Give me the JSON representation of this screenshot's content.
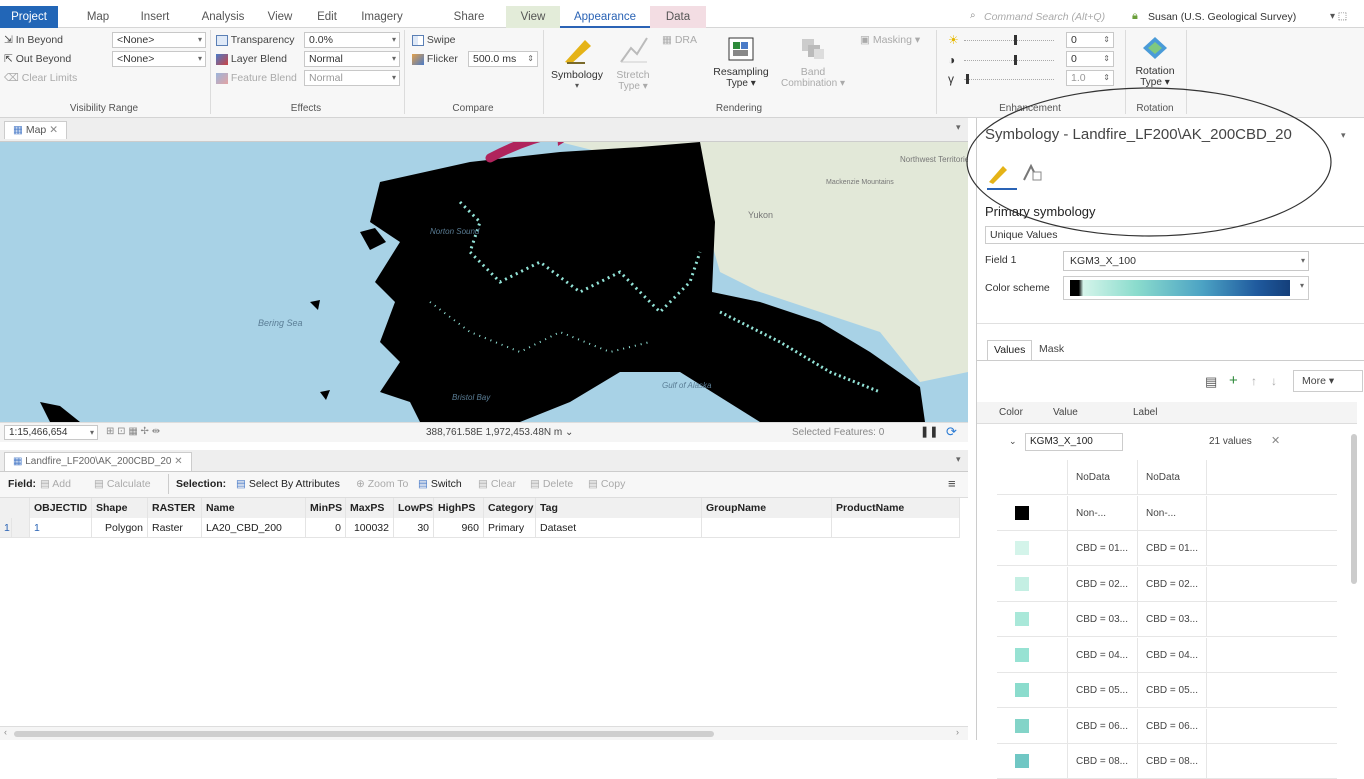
{
  "menubar": {
    "tabs": [
      "Project",
      "Map",
      "Insert",
      "Analysis",
      "View",
      "Edit",
      "Imagery",
      "Share",
      "View",
      "Appearance",
      "Data"
    ],
    "search_placeholder": "Command Search (Alt+Q)",
    "user": "Susan (U.S. Geological Survey)"
  },
  "ribbon": {
    "visibility": {
      "zoom_in_beyond": "In Beyond",
      "zoom_out_beyond": "Out Beyond",
      "clear_limits": "Clear Limits",
      "in_value": "<None>",
      "out_value": "<None>",
      "label": "Visibility Range"
    },
    "effects": {
      "transparency": "Transparency",
      "transparency_value": "0.0%",
      "layer_blend": "Layer Blend",
      "layer_blend_value": "Normal",
      "feature_blend": "Feature Blend",
      "feature_blend_value": "Normal",
      "label": "Effects"
    },
    "compare": {
      "swipe": "Swipe",
      "flicker": "Flicker",
      "flicker_value": "500.0",
      "flicker_unit": "ms",
      "label": "Compare"
    },
    "rendering": {
      "symbology": "Symbology",
      "stretch": "Stretch",
      "stretch_sub": "Type",
      "dra": "DRA",
      "resampling": "Resampling",
      "resampling_sub": "Type",
      "band": "Band",
      "band_sub": "Combination",
      "masking": "Masking",
      "label": "Rendering"
    },
    "enhancement": {
      "brightness": "0",
      "contrast": "0",
      "gamma": "1.0",
      "label": "Enhancement"
    },
    "rotation": {
      "label_top": "Rotation",
      "label_bottom": "Type",
      "label": "Rotation"
    }
  },
  "map": {
    "tab": "Map",
    "labels": {
      "north_sound": "Norton Sound",
      "bering": "Bering Sea",
      "bristol": "Bristol Bay",
      "gulf": "Gulf of Alaska",
      "yukon": "Yukon",
      "nwt": "Northwest Territories",
      "mackenzie": "Mackenzie Mountains"
    },
    "scale": "1:15,466,654",
    "coords": "388,761.58E 1,972,453.48N m",
    "selected": "Selected Features: 0"
  },
  "table": {
    "tab": "Landfire_LF200\\AK_200CBD_20",
    "toolbar": {
      "field": "Field:",
      "add": "Add",
      "calculate": "Calculate",
      "selection": "Selection:",
      "select_by_attr": "Select By Attributes",
      "zoom_to": "Zoom To",
      "switch": "Switch",
      "clear": "Clear",
      "delete": "Delete",
      "copy": "Copy"
    },
    "columns": [
      "OBJECTID",
      "Shape",
      "RASTER",
      "Name",
      "MinPS",
      "MaxPS",
      "LowPS",
      "HighPS",
      "Category",
      "Tag",
      "GroupName",
      "ProductName"
    ],
    "rows": [
      {
        "num": "1",
        "OBJECTID": "1",
        "Shape": "Polygon",
        "RASTER": "Raster",
        "Name": "LA20_CBD_200",
        "MinPS": "0",
        "MaxPS": "100032",
        "LowPS": "30",
        "HighPS": "960",
        "Category": "Primary",
        "Tag": "Dataset",
        "GroupName": "",
        "ProductName": ""
      }
    ]
  },
  "pane": {
    "title": "Symbology - Landfire_LF200\\AK_200CBD_20",
    "primary": "Primary symbology",
    "renderer": "Unique Values",
    "field1_label": "Field 1",
    "field1_value": "KGM3_X_100",
    "color_scheme_label": "Color scheme",
    "tabs": [
      "Values",
      "Mask"
    ],
    "more": "More",
    "col_color": "Color",
    "col_value": "Value",
    "col_label": "Label",
    "group_field": "KGM3_X_100",
    "group_count": "21 values",
    "values": [
      {
        "value": "NoData",
        "label": "NoData",
        "color": ""
      },
      {
        "value": "Non-...",
        "label": "Non-...",
        "color": "#000000"
      },
      {
        "value": "CBD = 01...",
        "label": "CBD = 01...",
        "color": "#d4f4ea"
      },
      {
        "value": "CBD = 02...",
        "label": "CBD = 02...",
        "color": "#c4efe3"
      },
      {
        "value": "CBD = 03...",
        "label": "CBD = 03...",
        "color": "#a9e8d9"
      },
      {
        "value": "CBD = 04...",
        "label": "CBD = 04...",
        "color": "#97e2d3"
      },
      {
        "value": "CBD = 05...",
        "label": "CBD = 05...",
        "color": "#8bdccd"
      },
      {
        "value": "CBD = 06...",
        "label": "CBD = 06...",
        "color": "#83d4c8"
      },
      {
        "value": "CBD = 08...",
        "label": "CBD = 08...",
        "color": "#70c7c4"
      }
    ]
  },
  "colors": {
    "accent": "#2266b7",
    "arrow": "#b0245c",
    "land": "#000000",
    "cyan": "#93e4d8",
    "sea": "#a8d2e6"
  }
}
